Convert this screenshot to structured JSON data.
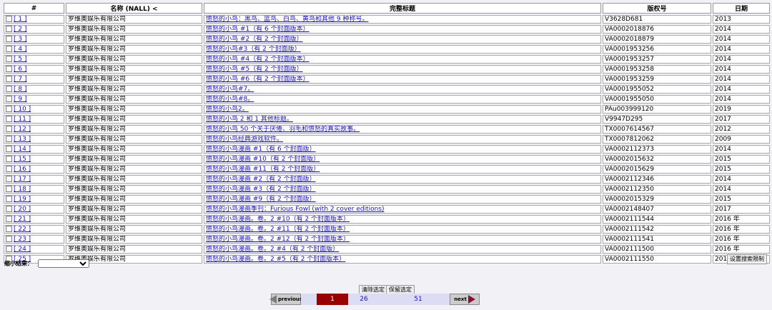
{
  "table": {
    "headers": {
      "num": "#",
      "name": "名称 (NALL) <",
      "title": "完整标题",
      "reg": "版权号",
      "date": "日期"
    },
    "rows": [
      {
        "num": "[ 1 ]",
        "name": "罗维奥娱乐有限公司",
        "title": "愤怒的小鸟：黑鸟、蓝鸟、白鸟、黄鸟和其他 9 种称号。",
        "reg": "V3628D681",
        "date": "2013"
      },
      {
        "num": "[ 2 ]",
        "name": "罗维奥娱乐有限公司",
        "title": "愤怒的小鸟 #1（有 6 个封面版本）",
        "reg": "VA0002018876",
        "date": "2014"
      },
      {
        "num": "[ 3 ]",
        "name": "罗维奥娱乐有限公司",
        "title": "愤怒的小鸟 #2（有 2 个封面版）",
        "reg": "VA0002018879",
        "date": "2014"
      },
      {
        "num": "[ 4 ]",
        "name": "罗维奥娱乐有限公司",
        "title": "愤怒的小鸟#3（有 2 个封面版）",
        "reg": "VA0001953256",
        "date": "2014"
      },
      {
        "num": "[ 5 ]",
        "name": "罗维奥娱乐有限公司",
        "title": "愤怒的小鸟 #4（有 2 个封面版本）",
        "reg": "VA0001953257",
        "date": "2014"
      },
      {
        "num": "[ 6 ]",
        "name": "罗维奥娱乐有限公司",
        "title": "愤怒的小鸟 #5（有 2 个封面版）",
        "reg": "VA0001953258",
        "date": "2014"
      },
      {
        "num": "[ 7 ]",
        "name": "罗维奥娱乐有限公司",
        "title": "愤怒的小鸟 #6（有 2 个封面版本）",
        "reg": "VA0001953259",
        "date": "2014"
      },
      {
        "num": "[ 8 ]",
        "name": "罗维奥娱乐有限公司",
        "title": "愤怒的小鸟#7。",
        "reg": "VA0001955052",
        "date": "2014"
      },
      {
        "num": "[ 9 ]",
        "name": "罗维奥娱乐有限公司",
        "title": "愤怒的小鸟#8。",
        "reg": "VA0001955050",
        "date": "2014"
      },
      {
        "num": "[ 10 ]",
        "name": "罗维奥娱乐有限公司",
        "title": "愤怒的小鸟2。",
        "reg": "PAu003999120",
        "date": "2019"
      },
      {
        "num": "[ 11 ]",
        "name": "罗维奥娱乐有限公司",
        "title": "愤怒的小鸟 2 和 1 其他标题。",
        "reg": "V9947D295",
        "date": "2017"
      },
      {
        "num": "[ 12 ]",
        "name": "罗维奥娱乐有限公司",
        "title": "愤怒的小鸟 50 个关于厌倦、羽毛和愤怒的真实故事。",
        "reg": "TX0007614567",
        "date": "2012"
      },
      {
        "num": "[ 13 ]",
        "name": "罗维奥娱乐有限公司",
        "title": "愤怒的小鸟经典游戏软件。",
        "reg": "TX0007812062",
        "date": "2009"
      },
      {
        "num": "[ 14 ]",
        "name": "罗维奥娱乐有限公司",
        "title": "愤怒的小鸟漫画 #1（有 6 个封面版）",
        "reg": "VA0002112373",
        "date": "2014"
      },
      {
        "num": "[ 15 ]",
        "name": "罗维奥娱乐有限公司",
        "title": "愤怒的小鸟漫画 #10（有 2 个封面版）",
        "reg": "VA0002015632",
        "date": "2015"
      },
      {
        "num": "[ 16 ]",
        "name": "罗维奥娱乐有限公司",
        "title": "愤怒的小鸟漫画 #11（有 2 个封面版）",
        "reg": "VA0002015629",
        "date": "2015"
      },
      {
        "num": "[ 17 ]",
        "name": "罗维奥娱乐有限公司",
        "title": "愤怒的小鸟漫画 #2（有 2 个封面版）",
        "reg": "VA0002112346",
        "date": "2014"
      },
      {
        "num": "[ 18 ]",
        "name": "罗维奥娱乐有限公司",
        "title": "愤怒的小鸟漫画 #3（有 2 个封面版）",
        "reg": "VA0002112350",
        "date": "2014"
      },
      {
        "num": "[ 19 ]",
        "name": "罗维奥娱乐有限公司",
        "title": "愤怒的小鸟漫画 #9（有 2 个封面版）",
        "reg": "VA0002015329",
        "date": "2015"
      },
      {
        "num": "[ 20 ]",
        "name": "罗维奥娱乐有限公司",
        "title": "愤怒的小鸟漫画季刊：Furious Fowl (with 2 cover editions)",
        "reg": "VA0002148407",
        "date": "2017"
      },
      {
        "num": "[ 21 ]",
        "name": "罗维奥娱乐有限公司",
        "title": "愤怒的小鸟漫画。卷。2 #10（有 2 个封面版本）",
        "reg": "VA0002111544",
        "date": "2016 年"
      },
      {
        "num": "[ 22 ]",
        "name": "罗维奥娱乐有限公司",
        "title": "愤怒的小鸟漫画。卷。2 #11（有 2 个封面版本）",
        "reg": "VA0002111542",
        "date": "2016 年"
      },
      {
        "num": "[ 23 ]",
        "name": "罗维奥娱乐有限公司",
        "title": "愤怒的小鸟漫画。卷。2 #12（有 2 个封面版本）",
        "reg": "VA0002111541",
        "date": "2016 年"
      },
      {
        "num": "[ 24 ]",
        "name": "罗维奥娱乐有限公司",
        "title": "愤怒的小鸟漫画。卷。2 #4（有 2 个封面版）",
        "reg": "VA0002111500",
        "date": "2016 年"
      },
      {
        "num": "[ 25 ]",
        "name": "罗维奥娱乐有限公司",
        "title": "愤怒的小鸟漫画。卷。2 #5（有 2 个封面版本）",
        "reg": "VA0002111550",
        "date": "2014"
      }
    ]
  },
  "refine": {
    "label": "缩小结果：",
    "selected": ""
  },
  "buttons": {
    "set_limits": "设置搜索限制",
    "clear_selected": "清除选定",
    "retain_selected": "保留选定"
  },
  "pager": {
    "previous": "previous",
    "next": "next",
    "current": "1",
    "page2": "26",
    "page3": "51"
  },
  "colors": {
    "link": "#1a12b5",
    "current_page": "#990000",
    "next_arrow": "#8a0f3d"
  }
}
